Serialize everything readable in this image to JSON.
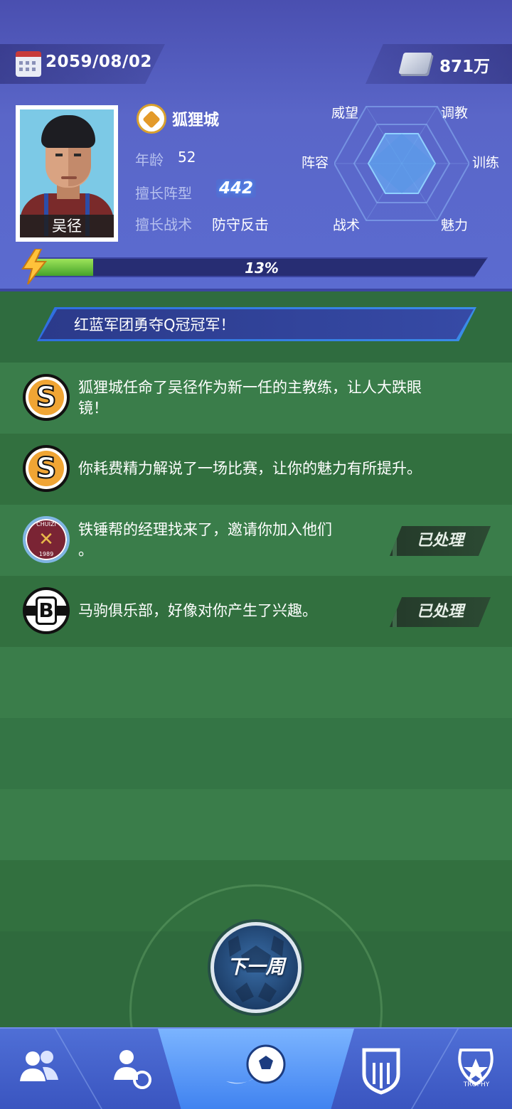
{
  "header": {
    "date": "2059/08/02",
    "money": "871万"
  },
  "manager": {
    "name": "吴径",
    "club": "狐狸城",
    "age_label": "年龄",
    "age": "52",
    "formation_label": "擅长阵型",
    "formation": "442",
    "tactic_label": "擅长战术",
    "tactic": "防守反击"
  },
  "radar": {
    "labels": {
      "top_left": "威望",
      "top_right": "调教",
      "left": "阵容",
      "right": "训练",
      "bottom_left": "战术",
      "bottom_right": "魅力"
    }
  },
  "progress": {
    "percent": 13,
    "label": "13%"
  },
  "banner": {
    "text": "红蓝军团勇夺Q冠冠军！"
  },
  "news": [
    {
      "icon": "sponsor-s-icon",
      "text_line1": "狐狸城任命了吴径作为新一任的主教练，让人大跌眼",
      "text_line2": "镜！"
    },
    {
      "icon": "sponsor-s-icon",
      "text_line1": "你耗费精力解说了一场比赛，让你的魅力有所提升。",
      "text_line2": ""
    },
    {
      "icon": "hammers-club-icon",
      "badge_top": "CHUIZI",
      "badge_year": "1989",
      "text_line1": "铁锤帮的经理找来了，邀请你加入他们",
      "text_line2": "。",
      "button": "已处理"
    },
    {
      "icon": "b-club-icon",
      "badge_letter": "B",
      "text_line1": "马驹俱乐部，好像对你产生了兴趣。",
      "text_line2": "",
      "button": "已处理"
    }
  ],
  "next_week": {
    "label": "下一周"
  },
  "nav": {
    "items": [
      "team-icon",
      "transfer-icon",
      "match-icon",
      "club-icon",
      "trophy-icon"
    ],
    "trophy_text": "TROPHY"
  },
  "colors": {
    "header": "#5a66c8",
    "pitch_light": "#3c7f4c",
    "pitch_dark": "#306a3f",
    "nav": "#4f6fd6"
  }
}
